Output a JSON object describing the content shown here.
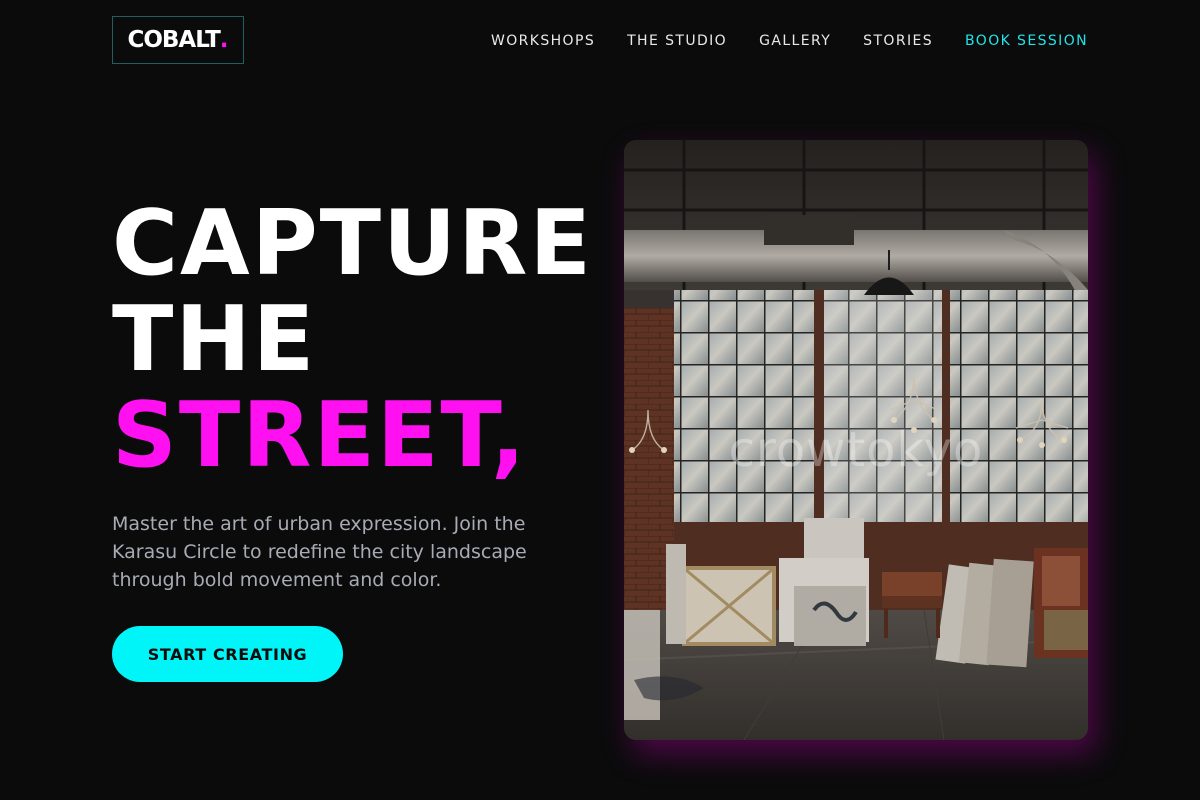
{
  "brand": {
    "name": "COBALT",
    "dot": ".",
    "accent_color": "#ff10f0",
    "cta_color": "#00f5f8"
  },
  "nav": {
    "items": [
      "WORKSHOPS",
      "THE STUDIO",
      "GALLERY",
      "STORIES"
    ],
    "cta": "BOOK SESSION"
  },
  "hero": {
    "headline_line1": "CAPTURE",
    "headline_line2": "THE",
    "headline_line3": "STREET,",
    "lede": "Master the art of urban expression. Join the Karasu Circle to redefine the city landscape through bold movement and color.",
    "button": "START CREATING"
  },
  "image": {
    "subject": "industrial loft art studio with chandeliers and canvases",
    "watermark": "crowtokyo"
  }
}
